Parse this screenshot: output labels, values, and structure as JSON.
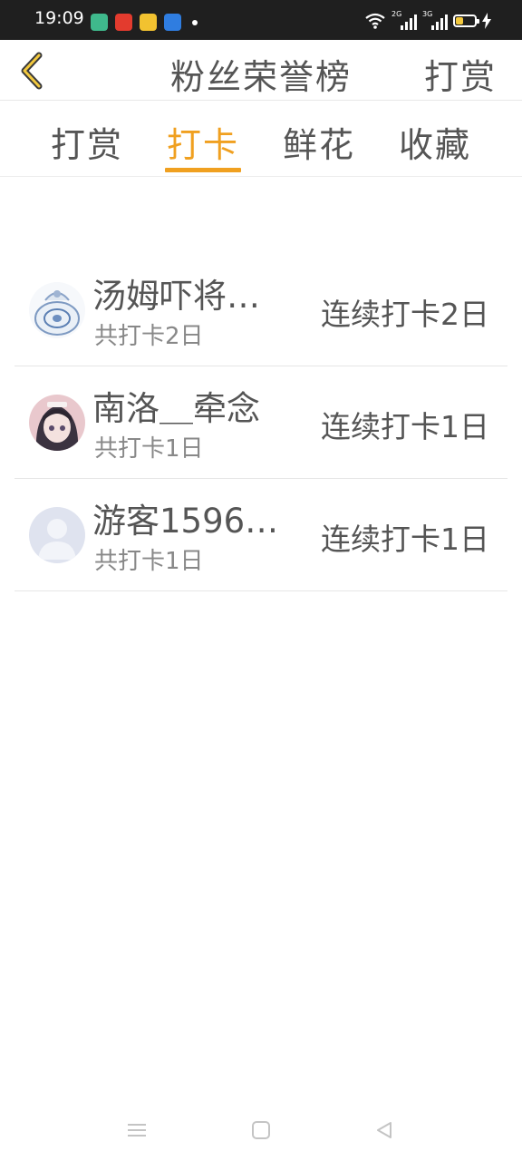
{
  "status_bar": {
    "time": "19:09",
    "signal_1": "2G",
    "signal_2": "3G"
  },
  "header": {
    "title": "粉丝荣誉榜",
    "right_action": "打赏"
  },
  "tabs": [
    {
      "label": "打赏",
      "active": false
    },
    {
      "label": "打卡",
      "active": true
    },
    {
      "label": "鲜花",
      "active": false
    },
    {
      "label": "收藏",
      "active": false
    }
  ],
  "rows": [
    {
      "name": "汤姆吓将…",
      "total": "共打卡2日",
      "streak": "连续打卡2日",
      "avatar": "porcelain-avatar"
    },
    {
      "name": "南洛＿牵念",
      "total": "共打卡1日",
      "streak": "连续打卡1日",
      "avatar": "anime-girl-avatar"
    },
    {
      "name": "游客1596…",
      "total": "共打卡1日",
      "streak": "连续打卡1日",
      "avatar": "default-user-avatar"
    }
  ],
  "colors": {
    "accent": "#f0a020",
    "text": "#555555",
    "subtext": "#888888",
    "statusbar": "#1f1f1f"
  },
  "icons": {
    "back": "chevron-left-icon",
    "nav_menu": "menu-icon",
    "nav_home": "home-square-icon",
    "nav_back": "back-triangle-icon"
  }
}
